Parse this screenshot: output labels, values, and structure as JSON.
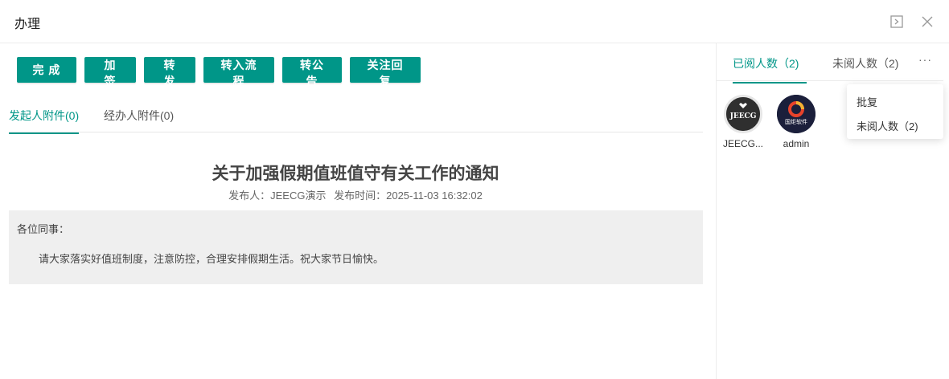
{
  "header": {
    "title": "办理",
    "icons": [
      "expand-icon",
      "close-icon"
    ]
  },
  "toolbar": {
    "complete": "完 成",
    "add_sign": "加 签",
    "forward": "转 发",
    "to_process": "转入流程",
    "to_notice": "转公告",
    "follow_reply": "关注回复"
  },
  "attachments": {
    "tabs": [
      "发起人附件(0)",
      "经办人附件(0)"
    ],
    "active_index": 0
  },
  "document": {
    "title": "关于加强假期值班值守有关工作的通知",
    "publisher_label": "发布人：JEECG演示",
    "time_label": "发布时间：2025-11-03 16:32:02",
    "greeting": "各位同事：",
    "body": "请大家落实好值班制度，注意防控，合理安排假期生活。祝大家节日愉快。"
  },
  "readers_panel": {
    "tabs": {
      "read": "已阅人数（2)",
      "unread": "未阅人数（2)"
    },
    "more": "···",
    "readers": [
      {
        "name": "JEECG...",
        "avatar": "JEECG",
        "avatar_icon": "jeecg-logo-icon"
      },
      {
        "name": "admin",
        "avatar": "国炬软件",
        "avatar_icon": "guoju-logo-icon"
      }
    ],
    "dropdown": [
      "批复",
      "未阅人数（2)"
    ]
  },
  "colors": {
    "accent": "#009688",
    "content_bg": "#efefef",
    "border": "#ececec"
  }
}
